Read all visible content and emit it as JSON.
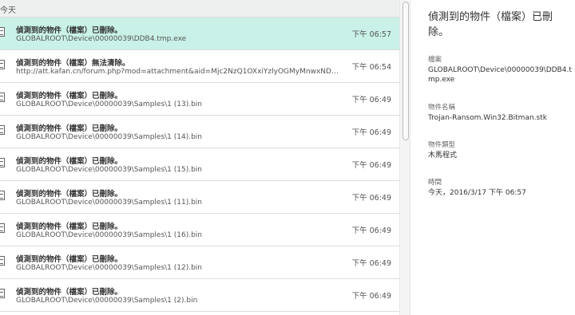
{
  "list": {
    "group_label": "今天",
    "rows": [
      {
        "title": "偵測到的物件（檔案）已刪除。",
        "path": "GLOBALROOT\\Device\\00000039\\DDB4.tmp.exe",
        "time": "下午 06:57"
      },
      {
        "title": "偵測到的物件（檔案）無法清除。",
        "path": "http://att.kafan.cn/forum.php?mod=attachment&aid=Mjc2NzQ1OXxiYzlyOGMyMnwxNDU4...",
        "time": "下午 06:54"
      },
      {
        "title": "偵測到的物件（檔案）已刪除。",
        "path": "GLOBALROOT\\Device\\00000039\\Samples\\1 (13).bin",
        "time": "下午 06:49"
      },
      {
        "title": "偵測到的物件（檔案）已刪除。",
        "path": "GLOBALROOT\\Device\\00000039\\Samples\\1 (14).bin",
        "time": "下午 06:49"
      },
      {
        "title": "偵測到的物件（檔案）已刪除。",
        "path": "GLOBALROOT\\Device\\00000039\\Samples\\1 (15).bin",
        "time": "下午 06:49"
      },
      {
        "title": "偵測到的物件（檔案）已刪除。",
        "path": "GLOBALROOT\\Device\\00000039\\Samples\\1 (11).bin",
        "time": "下午 06:49"
      },
      {
        "title": "偵測到的物件（檔案）已刪除。",
        "path": "GLOBALROOT\\Device\\00000039\\Samples\\1 (16).bin",
        "time": "下午 06:49"
      },
      {
        "title": "偵測到的物件（檔案）已刪除。",
        "path": "GLOBALROOT\\Device\\00000039\\Samples\\1 (12).bin",
        "time": "下午 06:49"
      },
      {
        "title": "偵測到的物件（檔案）已刪除。",
        "path": "GLOBALROOT\\Device\\00000039\\Samples\\1 (2).bin",
        "time": "下午 06:49"
      }
    ]
  },
  "detail": {
    "title": "偵測到的物件（檔案）已刪除。",
    "file_label": "檔案",
    "file_value": "GLOBALROOT\\Device\\00000039\\DDB4.tmp.exe",
    "object_name_label": "物件名稱",
    "object_name_value": "Trojan-Ransom.Win32.Bitman.stk",
    "object_type_label": "物件類型",
    "object_type_value": "木馬程式",
    "time_label": "時間",
    "time_value": "今天，2016/3/17 下午 06:57"
  },
  "colors": {
    "selected_row": "#c9f1e8",
    "group_header": "#eef0f0"
  },
  "icons": {
    "row_icon": "document-icon"
  }
}
